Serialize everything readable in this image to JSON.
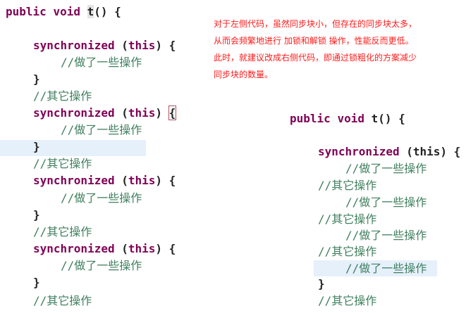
{
  "note": [
    "对于左侧代码，虽然同步块小，但存在的同步块太多，",
    "从而会频繁地进行 加锁和解锁 操作，性能反而更低。",
    "此时，就建议改成右侧代码，即通过锁粗化的方案减少",
    "同步块的数量。"
  ],
  "code": {
    "kw_public": "public",
    "kw_void": "void",
    "method": "t",
    "method_tail": "() {",
    "kw_sync": "synchronized",
    "sync_tail": " (this) {",
    "this_kw": "this",
    "comment_work": "//做了一些操作",
    "comment_other": "//其它操作",
    "close": "}"
  }
}
